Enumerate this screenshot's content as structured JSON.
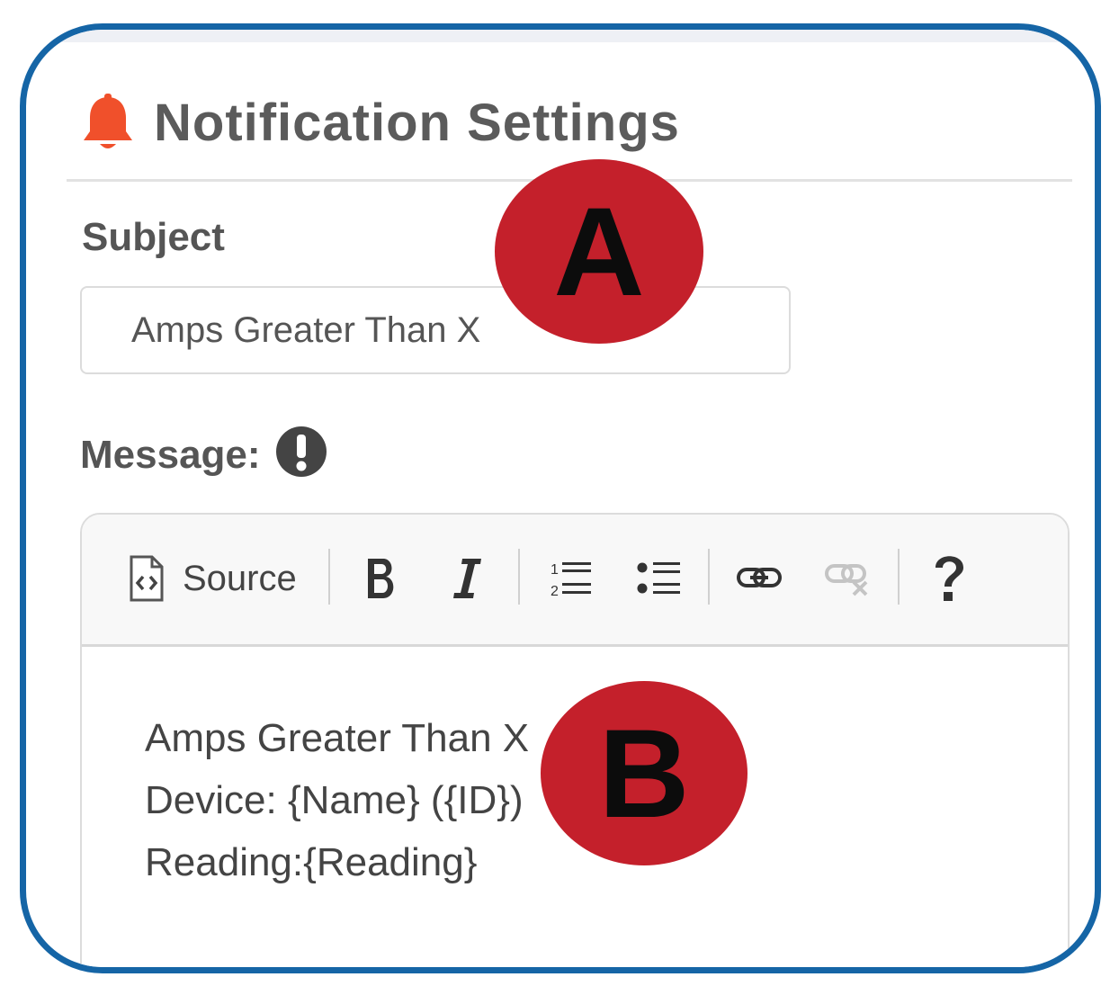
{
  "header": {
    "title": "Notification Settings",
    "icon": "bell-icon",
    "icon_color": "#f0502b"
  },
  "subject": {
    "label": "Subject",
    "value": "Amps Greater Than X"
  },
  "message": {
    "label": "Message:",
    "info_icon": "exclamation-circle-icon"
  },
  "toolbar": {
    "source_label": "Source",
    "buttons": [
      "source",
      "bold",
      "italic",
      "numbered-list",
      "bulleted-list",
      "link",
      "unlink",
      "help"
    ]
  },
  "editor": {
    "lines": [
      "Amps Greater Than X",
      "Device: {Name} ({ID})",
      "Reading:{Reading}"
    ]
  },
  "markers": {
    "a": "A",
    "b": "B",
    "color": "#c4202b"
  },
  "frame_color": "#1565a6"
}
